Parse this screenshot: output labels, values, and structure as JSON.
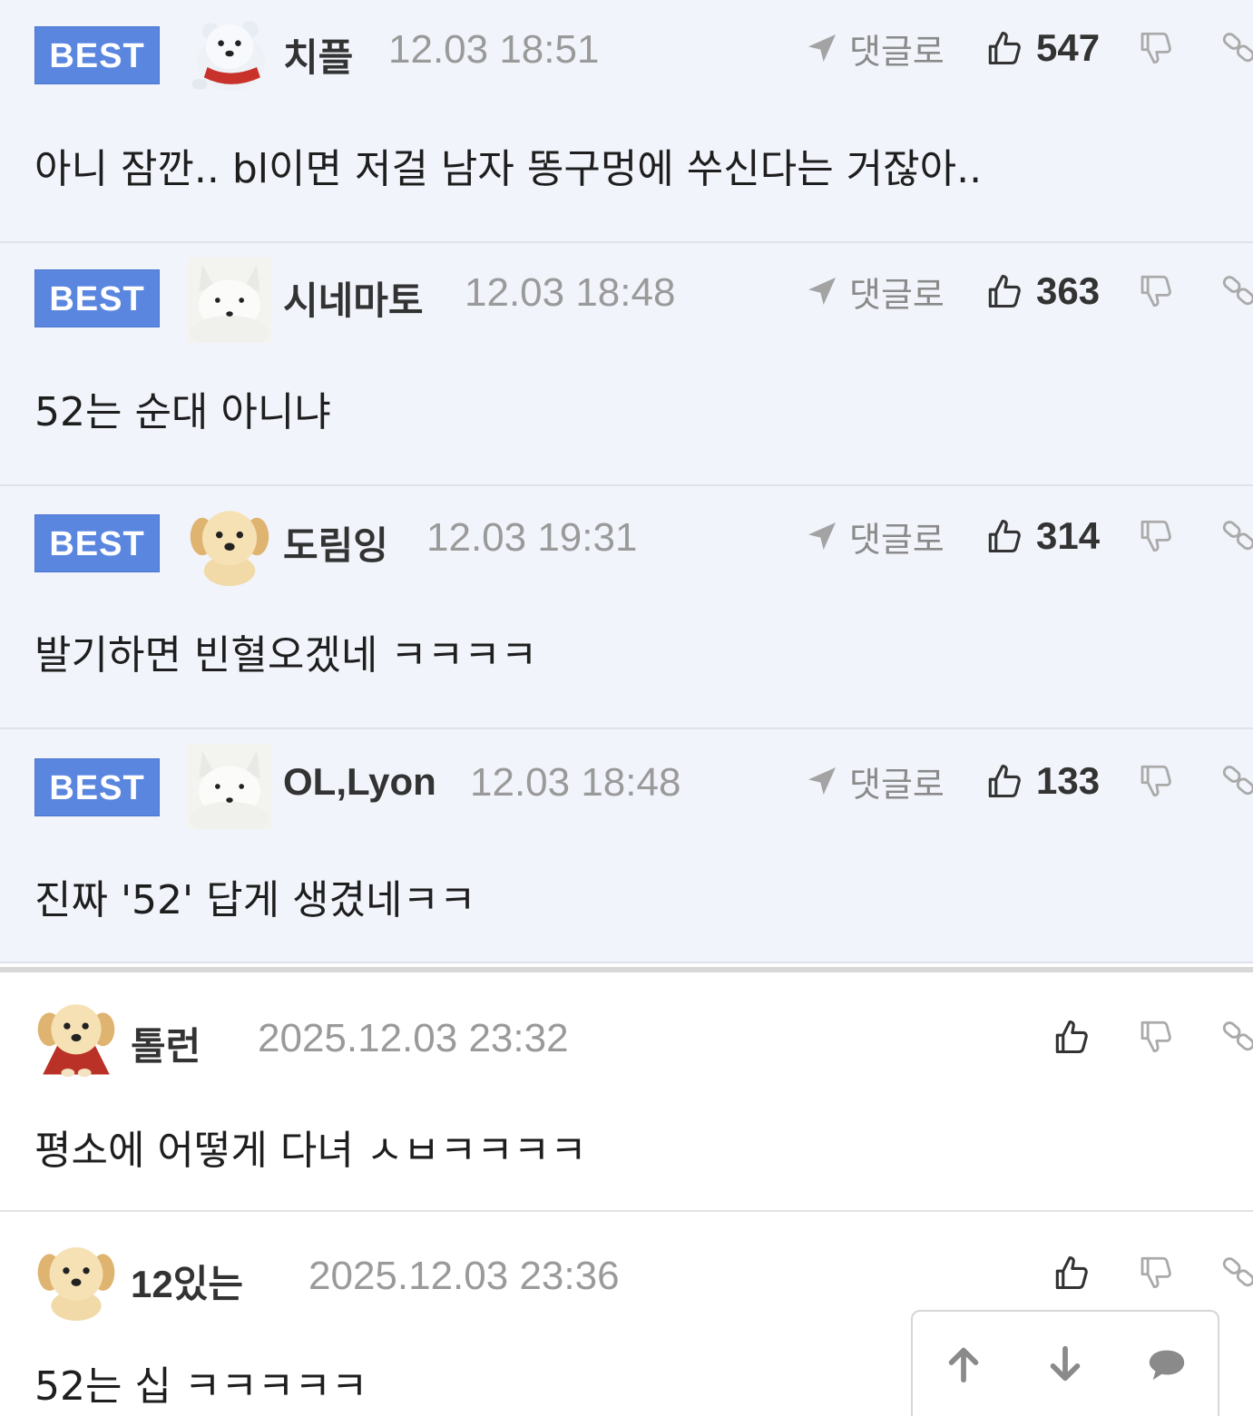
{
  "best_comments": [
    {
      "badge": "BEST",
      "nickname": "치플",
      "date": "12.03 18:51",
      "reply_label": "댓글로",
      "likes": "547",
      "text": "아니 잠깐.. bl이면 저걸 남자 똥구멍에 쑤신다는 거잖아..",
      "avatar_icon": "polar-bear-avatar-icon"
    },
    {
      "badge": "BEST",
      "nickname": "시네마토",
      "date": "12.03 18:48",
      "reply_label": "댓글로",
      "likes": "363",
      "text": "52는 순대 아니냐",
      "avatar_icon": "white-fox-avatar-icon"
    },
    {
      "badge": "BEST",
      "nickname": "도림잉",
      "date": "12.03 19:31",
      "reply_label": "댓글로",
      "likes": "314",
      "text": "발기하면 빈혈오겠네 ㅋㅋㅋㅋ",
      "avatar_icon": "puppy-avatar-icon"
    },
    {
      "badge": "BEST",
      "nickname": "OL,Lyon",
      "date": "12.03 18:48",
      "reply_label": "댓글로",
      "likes": "133",
      "text": "진짜 '52' 답게 생겼네ㅋㅋ",
      "avatar_icon": "white-fox-avatar-icon"
    }
  ],
  "comments": [
    {
      "nickname": "톨런",
      "date": "2025.12.03 23:32",
      "text": "평소에 어떻게 다녀 ㅅㅂㅋㅋㅋㅋ",
      "avatar_icon": "puppy-red-cape-avatar-icon"
    },
    {
      "nickname": "12있는",
      "date": "2025.12.03 23:36",
      "text": "52는 십 ㅋㅋㅋㅋㅋ",
      "avatar_icon": "puppy-avatar-icon"
    }
  ],
  "floating_nav": {
    "icons": [
      "arrow-up-icon",
      "arrow-down-icon",
      "comment-bubble-icon"
    ]
  },
  "colors": {
    "best_background": "#f2f4fb",
    "best_badge": "#5a86e0",
    "date_text": "#9a9a9a",
    "icon_gray": "#9a9a9a"
  }
}
